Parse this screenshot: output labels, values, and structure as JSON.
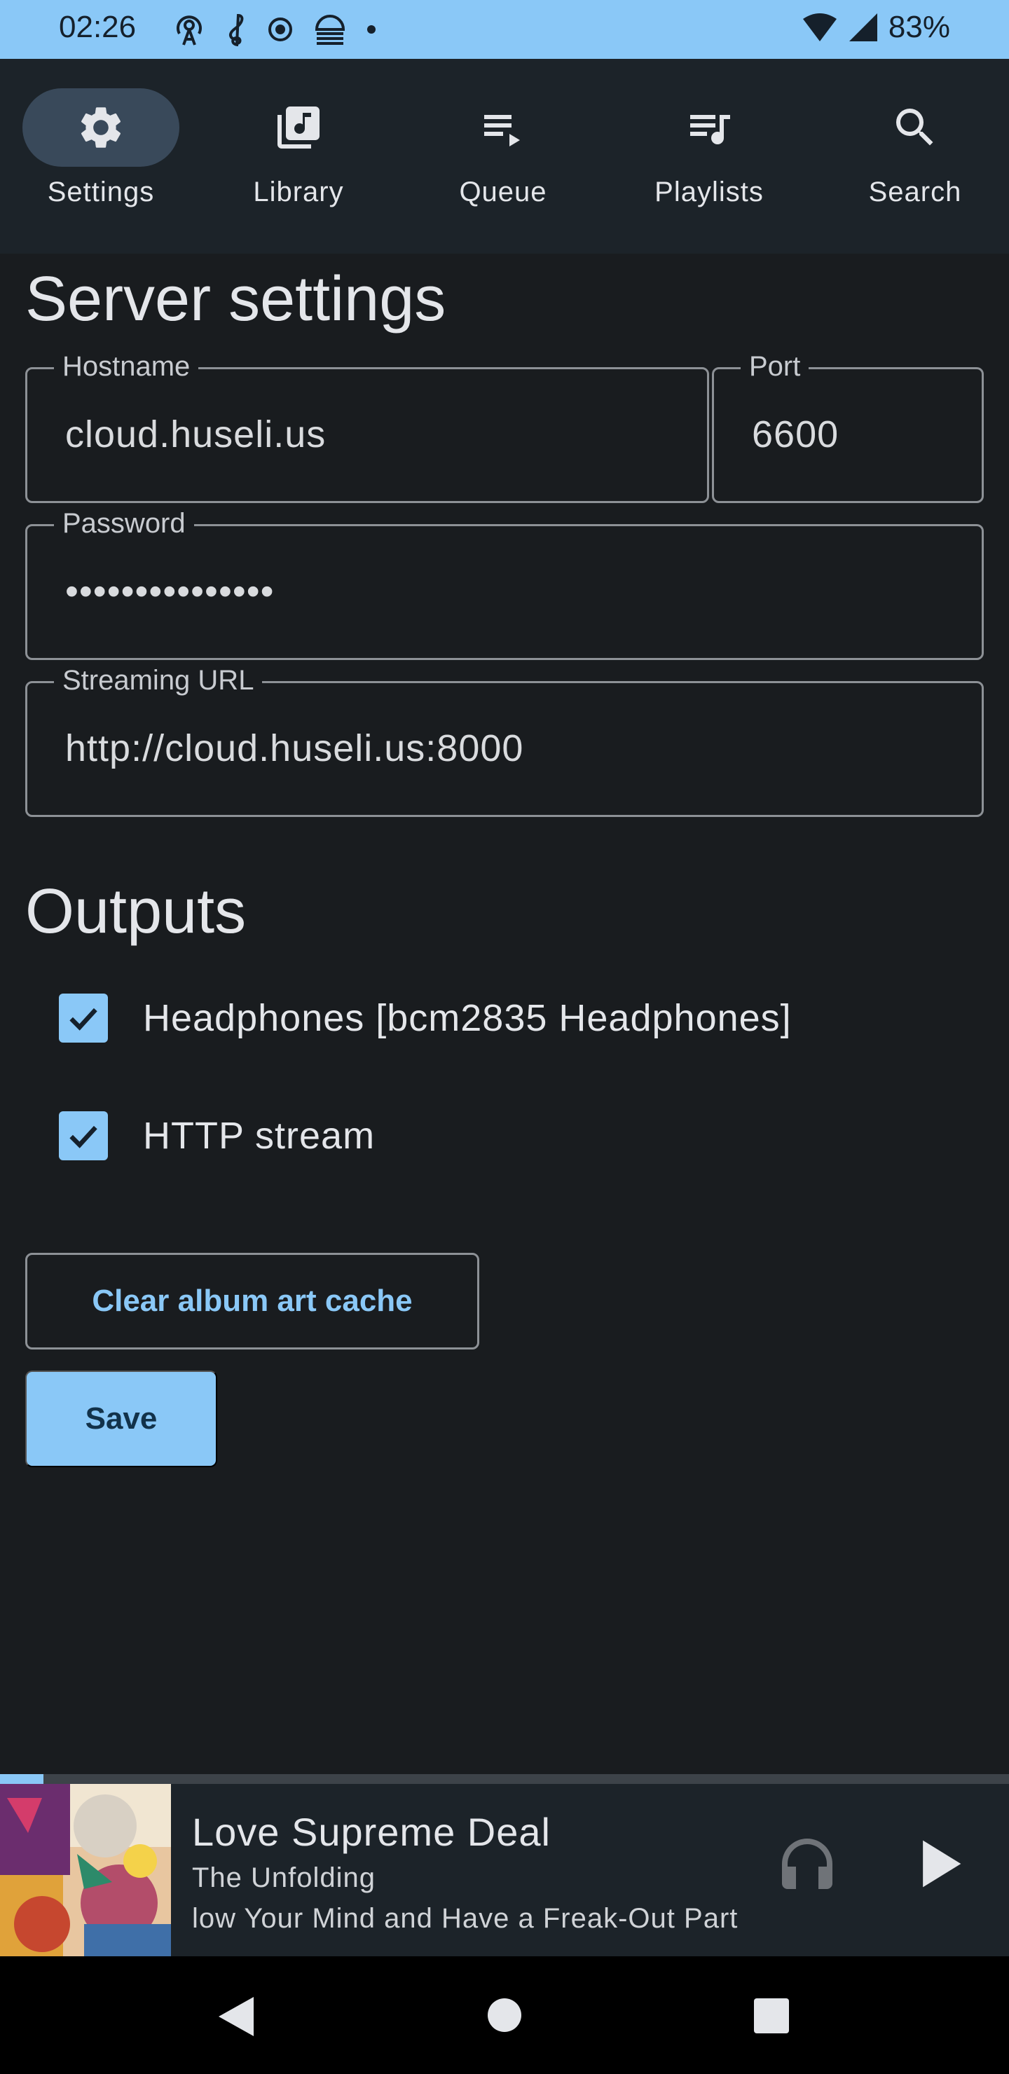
{
  "status_bar": {
    "time": "02:26",
    "battery": "83%"
  },
  "nav": {
    "items": [
      {
        "label": "Settings",
        "icon": "gear-icon",
        "active": true
      },
      {
        "label": "Library",
        "icon": "library-music-icon",
        "active": false
      },
      {
        "label": "Queue",
        "icon": "queue-play-icon",
        "active": false
      },
      {
        "label": "Playlists",
        "icon": "playlist-music-icon",
        "active": false
      },
      {
        "label": "Search",
        "icon": "search-icon",
        "active": false
      }
    ]
  },
  "server_settings": {
    "title": "Server settings",
    "hostname": {
      "label": "Hostname",
      "value": "cloud.huseli.us"
    },
    "port": {
      "label": "Port",
      "value": "6600"
    },
    "password": {
      "label": "Password",
      "value": "•••••••••••••••"
    },
    "streaming_url": {
      "label": "Streaming URL",
      "value": "http://cloud.huseli.us:8000"
    }
  },
  "outputs": {
    "title": "Outputs",
    "items": [
      {
        "label": "Headphones [bcm2835 Headphones]",
        "checked": true
      },
      {
        "label": "HTTP stream",
        "checked": true
      }
    ]
  },
  "buttons": {
    "clear_cache": "Clear album art cache",
    "save": "Save"
  },
  "player": {
    "progress": 0.043,
    "title": "Love Supreme Deal",
    "album": "The Unfolding",
    "line3": "low Your Mind and Have a Freak-Out Part"
  },
  "colors": {
    "accent": "#8ac8f7",
    "background": "#191c1f",
    "surface": "#1c2329"
  }
}
